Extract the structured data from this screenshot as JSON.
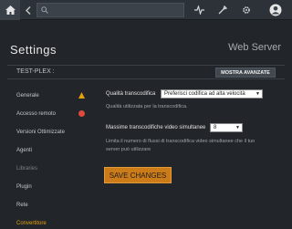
{
  "topbar": {
    "search_placeholder": "",
    "icons": [
      "home-icon",
      "back-icon",
      "search-icon",
      "activity-icon",
      "tools-icon",
      "settings-icon",
      "account-icon"
    ]
  },
  "header": {
    "title": "Settings",
    "section": "Web Server",
    "server_name": "TEST-PLEX :",
    "advanced_button": "MOSTRA AVANZATE"
  },
  "sidebar": {
    "items": [
      {
        "label": "Generale",
        "status": "warning"
      },
      {
        "label": "Accesso remoto",
        "status": "error"
      },
      {
        "label": "Versioni Ottimizzate",
        "status": ""
      },
      {
        "label": "Agenti",
        "status": ""
      },
      {
        "label": "Libraries",
        "status": "dim"
      },
      {
        "label": "Plugin",
        "status": ""
      },
      {
        "label": "Rete",
        "status": ""
      },
      {
        "label": "Convertitore",
        "status": "active"
      }
    ]
  },
  "transcoder": {
    "quality_label": "Qualità transcodifica",
    "quality_value": "Preferisci codifica ad alta velocità",
    "quality_help": "Qualità utilizzata per la transcodifica.",
    "max_label": "Massime transcodifiche video simultanee",
    "max_value": "8",
    "max_help": "Limita il numero di flussi di transcodifica video simultanee che il tuo server può utilizzare"
  },
  "save_button": "SAVE CHANGES",
  "colors": {
    "accent": "#cc7b19",
    "active_nav": "#e5a00d",
    "warning": "#e5a00d",
    "error": "#e04a3b",
    "background": "#22262b"
  }
}
